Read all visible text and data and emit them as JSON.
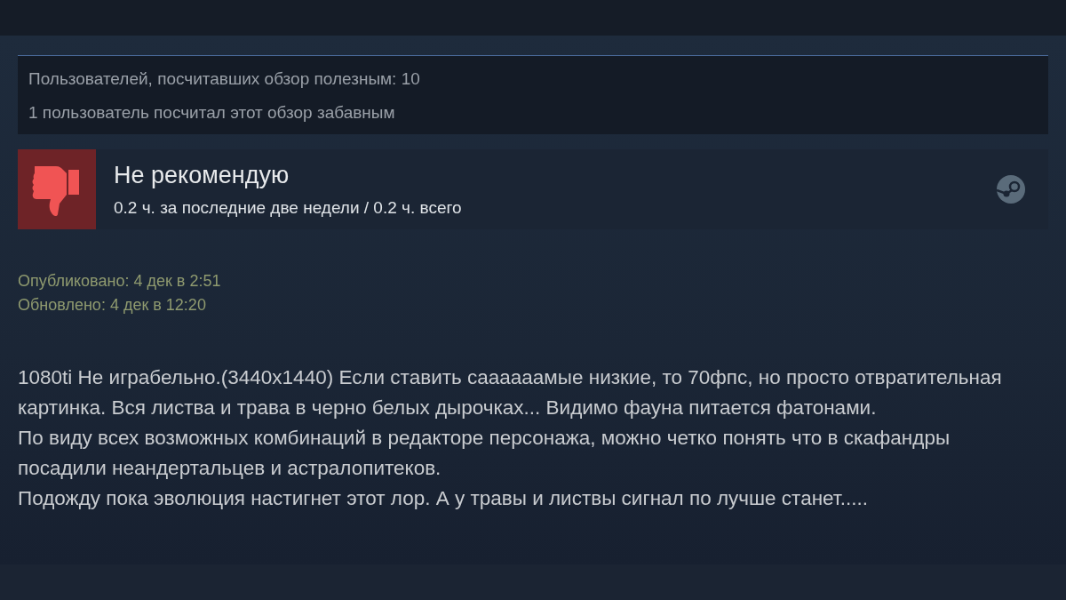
{
  "helpful": {
    "lines": [
      "Пользователей, посчитавших обзор полезным: 10",
      "1 пользователь посчитал этот обзор забавным"
    ]
  },
  "verdict": {
    "recommended": false,
    "title": "Не рекомендую",
    "hours": "0.2 ч. за последние две недели / 0.2 ч. всего"
  },
  "dates": [
    "Опубликовано: 4 дек в 2:51",
    "Обновлено: 4 дек в 12:20"
  ],
  "body": [
    "1080ti Не играбельно.(3440x1440) Если ставить саааааамые низкие, то 70фпс, но просто отвратительная картинка. Вся листва и трава в черно белых дырочках... Видимо фауна питается фатонами.",
    "По виду всех возможных комбинаций в редакторе персонажа, можно четко понять что в скафандры посадили неандертальцев и астралопитеков.",
    "Подожду пока эволюция настигнет этот лор. А у травы и листвы сигнал по лучше станет....."
  ]
}
